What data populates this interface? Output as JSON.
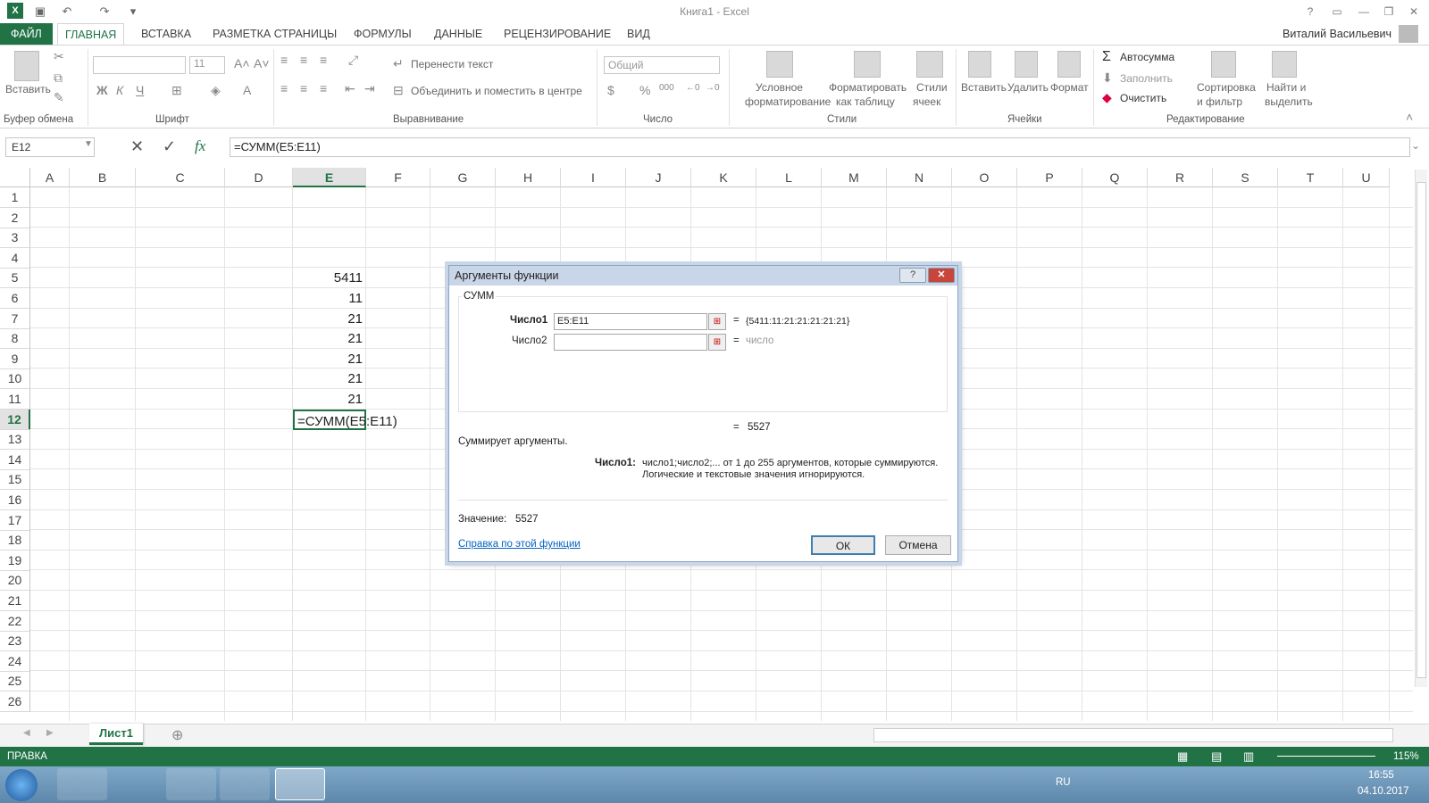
{
  "window": {
    "title": "Книга1 - Excel",
    "user": "Виталий Васильевич"
  },
  "ribbon_tabs": [
    "ФАЙЛ",
    "ГЛАВНАЯ",
    "ВСТАВКА",
    "РАЗМЕТКА СТРАНИЦЫ",
    "ФОРМУЛЫ",
    "ДАННЫЕ",
    "РЕЦЕНЗИРОВАНИЕ",
    "ВИД"
  ],
  "ribbon": {
    "paste": "Вставить",
    "font_size": "11",
    "bold": "Ж",
    "italic": "К",
    "underline": "Ч",
    "wrap_text": "Перенести текст",
    "merge_center": "Объединить и поместить в центре",
    "number_format": "Общий",
    "cond_format": [
      "Условное",
      "форматирование"
    ],
    "format_table": [
      "Форматировать",
      "как таблицу"
    ],
    "cell_styles": [
      "Стили",
      "ячеек"
    ],
    "insert": "Вставить",
    "delete": "Удалить",
    "format": "Формат",
    "autosum": "Автосумма",
    "fill": "Заполнить",
    "clear": "Очистить",
    "sort_filter": [
      "Сортировка",
      "и фильтр"
    ],
    "find_select": [
      "Найти и",
      "выделить"
    ],
    "groups": {
      "clipboard": "Буфер обмена",
      "font": "Шрифт",
      "alignment": "Выравнивание",
      "number": "Число",
      "styles": "Стили",
      "cells": "Ячейки",
      "editing": "Редактирование"
    }
  },
  "formula_bar": {
    "name_box": "E12",
    "formula": "=СУММ(E5:E11)",
    "fx": "fx"
  },
  "columns": [
    "A",
    "B",
    "C",
    "D",
    "E",
    "F",
    "G",
    "H",
    "I",
    "J",
    "K",
    "L",
    "M",
    "N",
    "O",
    "P",
    "Q",
    "R",
    "S",
    "T",
    "U"
  ],
  "rows": [
    "1",
    "2",
    "3",
    "4",
    "5",
    "6",
    "7",
    "8",
    "9",
    "10",
    "11",
    "12",
    "13",
    "14",
    "15",
    "16",
    "17",
    "18",
    "19",
    "20",
    "21",
    "22",
    "23",
    "24",
    "25",
    "26"
  ],
  "cells": {
    "E5": "5411",
    "E6": "11",
    "E7": "21",
    "E8": "21",
    "E9": "21",
    "E10": "21",
    "E11": "21",
    "E12": "=СУММ(E5:E11)"
  },
  "dialog": {
    "title": "Аргументы функции",
    "help_btn": "?",
    "close_btn": "✕",
    "function": "СУММ",
    "arg1_label": "Число1",
    "arg1_value": "E5:E11",
    "arg1_result": "{5411:11:21:21:21:21:21}",
    "arg2_label": "Число2",
    "arg2_value": "",
    "arg2_result": "число",
    "eq": "=",
    "total": "5527",
    "description": "Суммирует аргументы.",
    "arg_help_label": "Число1:",
    "arg_help_line1": "число1;число2;... от 1 до 255 аргументов, которые суммируются.",
    "arg_help_line2": "Логические и текстовые значения игнорируются.",
    "value_label": "Значение:",
    "value": "5527",
    "help_link": "Справка по этой функции",
    "ok": "ОК",
    "cancel": "Отмена"
  },
  "sheet_tabs": [
    "Лист1"
  ],
  "status": {
    "mode": "ПРАВКА",
    "zoom": "115%"
  },
  "taskbar": {
    "lang": "RU",
    "time": "16:55",
    "date": "04.10.2017"
  },
  "colors": {
    "excel_green": "#217346",
    "dialog_title": "#c9d6e8",
    "taskbar": "#6b93b6"
  }
}
